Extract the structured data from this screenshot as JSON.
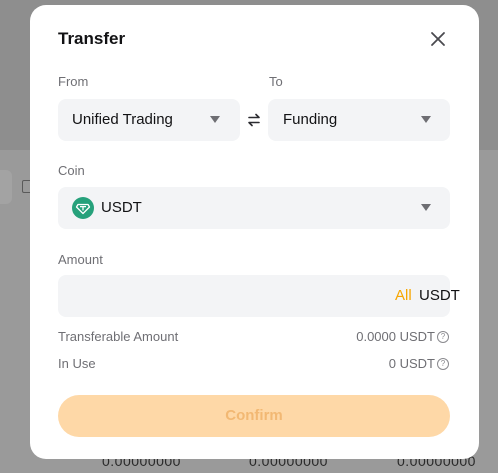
{
  "background": {
    "row_values": [
      "0.00000000",
      "0.00000000",
      "0.00000000"
    ]
  },
  "modal": {
    "title": "Transfer",
    "from": {
      "label": "From",
      "value": "Unified Trading"
    },
    "to": {
      "label": "To",
      "value": "Funding"
    },
    "coin": {
      "label": "Coin",
      "value": "USDT",
      "icon": "tether-icon"
    },
    "amount": {
      "label": "Amount",
      "value": "",
      "all_label": "All",
      "unit": "USDT"
    },
    "transferable": {
      "label": "Transferable Amount",
      "value": "0.0000 USDT"
    },
    "in_use": {
      "label": "In Use",
      "value": "0 USDT"
    },
    "confirm_label": "Confirm"
  },
  "colors": {
    "accent": "#f7a600",
    "confirm_disabled_bg": "#fed8a7",
    "confirm_disabled_text": "#f2b873",
    "tether": "#26a17b",
    "field_bg": "#f3f4f6"
  }
}
